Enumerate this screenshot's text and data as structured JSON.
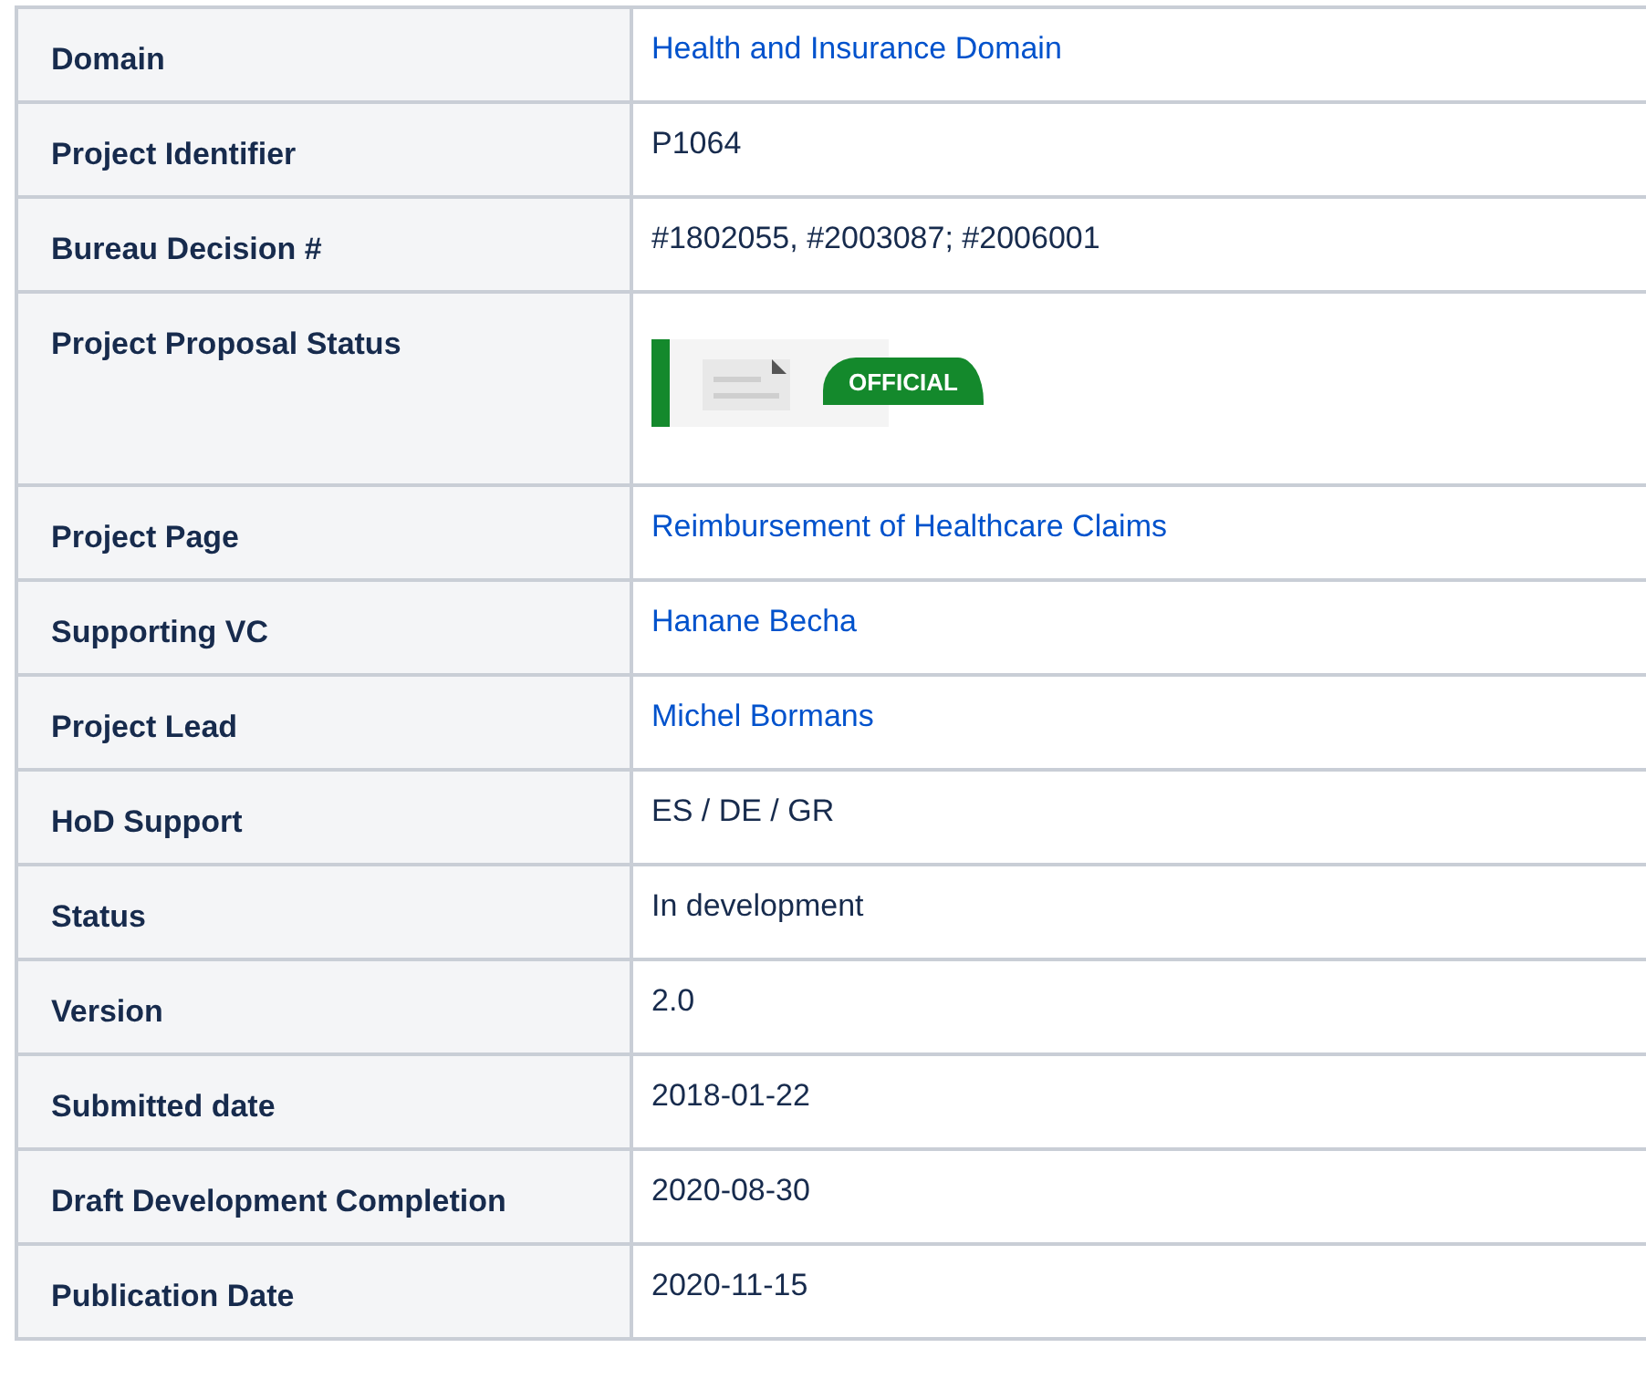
{
  "rows": [
    {
      "label": "Domain",
      "kind": "link",
      "value": "Health and Insurance Domain"
    },
    {
      "label": "Project Identifier",
      "kind": "text",
      "value": "P1064"
    },
    {
      "label": "Bureau Decision #",
      "kind": "text",
      "value": "#1802055, #2003087; #2006001"
    },
    {
      "label": "Project Proposal Status",
      "kind": "status",
      "value": "OFFICIAL"
    },
    {
      "label": "Project Page",
      "kind": "link",
      "value": "Reimbursement of Healthcare Claims"
    },
    {
      "label": "Supporting VC",
      "kind": "link",
      "value": "Hanane Becha"
    },
    {
      "label": "Project Lead",
      "kind": "link",
      "value": "Michel Bormans"
    },
    {
      "label": "HoD Support",
      "kind": "text",
      "value": "ES / DE / GR"
    },
    {
      "label": "Status",
      "kind": "text",
      "value": "In development"
    },
    {
      "label": "Version",
      "kind": "text",
      "value": "2.0"
    },
    {
      "label": "Submitted date",
      "kind": "text",
      "value": "2018-01-22"
    },
    {
      "label": "Draft Development Completion",
      "kind": "text",
      "value": "2020-08-30"
    },
    {
      "label": "Publication Date",
      "kind": "text",
      "value": "2020-11-15"
    }
  ]
}
